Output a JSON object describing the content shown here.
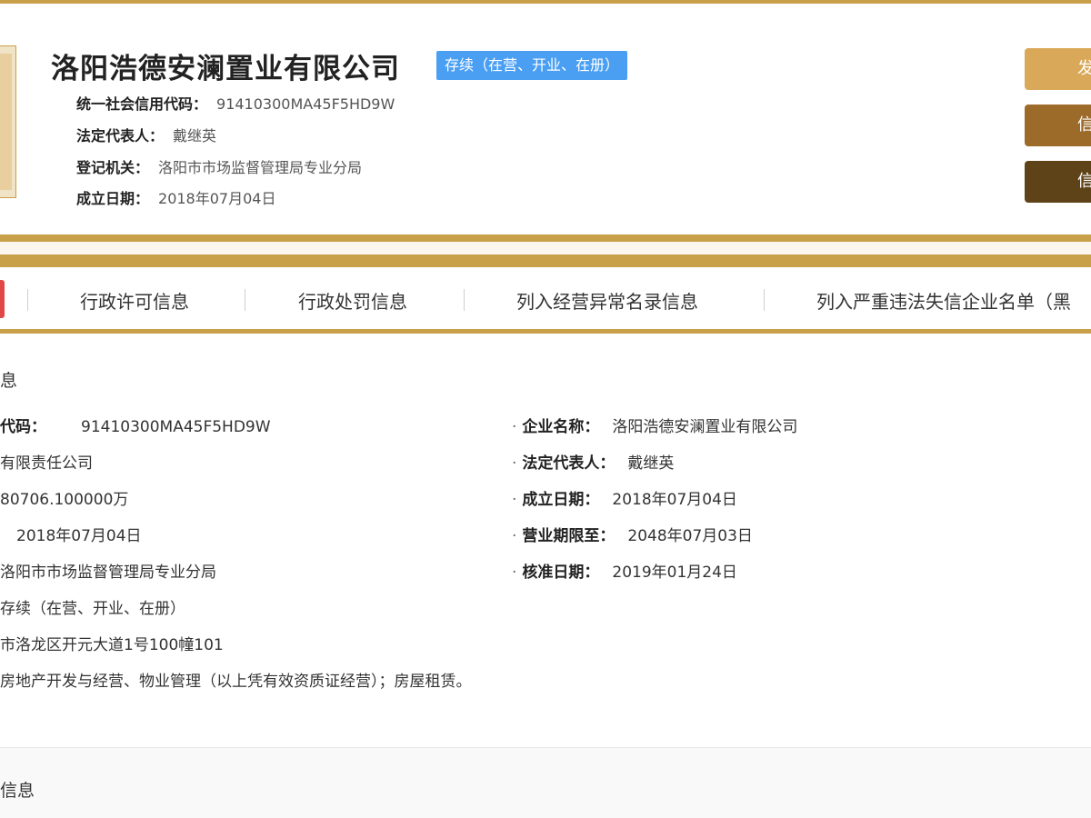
{
  "header": {
    "company_name": "洛阳浩德安澜置业有限公司",
    "status_badge": "存续（在营、开业、在册）",
    "rows": [
      {
        "label": "统一社会信用代码：",
        "value": "91410300MA45F5HD9W"
      },
      {
        "label": "法定代表人：",
        "value": "戴继英"
      },
      {
        "label": "登记机关：",
        "value": "洛阳市市场监督管理局专业分局"
      },
      {
        "label": "成立日期：",
        "value": "2018年07月04日"
      }
    ],
    "side_buttons": [
      "发",
      "信",
      "信"
    ]
  },
  "tabs": [
    "行政许可信息",
    "行政处罚信息",
    "列入经营异常名录信息",
    "列入严重违法失信企业名单（黑"
  ],
  "basic_info": {
    "title": "息",
    "left_rows": [
      {
        "label": "代码：",
        "value": "91410300MA45F5HD9W"
      },
      {
        "label": "",
        "value": "有限责任公司"
      },
      {
        "label": "",
        "value": "80706.100000万"
      },
      {
        "label": "",
        "value": "2018年07月04日"
      },
      {
        "label": "",
        "value": "洛阳市市场监督管理局专业分局"
      },
      {
        "label": "",
        "value": "存续（在营、开业、在册）"
      },
      {
        "label": "",
        "value": "市洛龙区开元大道1号100幢101"
      },
      {
        "label": "",
        "value": "房地产开发与经营、物业管理（以上凭有效资质证经营）；房屋租赁。"
      }
    ],
    "right_rows": [
      {
        "label": "企业名称：",
        "value": "洛阳浩德安澜置业有限公司"
      },
      {
        "label": "法定代表人：",
        "value": "戴继英"
      },
      {
        "label": "成立日期：",
        "value": "2018年07月04日"
      },
      {
        "label": "营业期限至：",
        "value": "2048年07月03日"
      },
      {
        "label": "核准日期：",
        "value": "2019年01月24日"
      }
    ]
  },
  "next_section": {
    "title": "信息"
  },
  "colors": {
    "accent_gold": "#c9a04a",
    "badge_blue": "#4a9ff3",
    "active_tab_red": "#e24747"
  }
}
